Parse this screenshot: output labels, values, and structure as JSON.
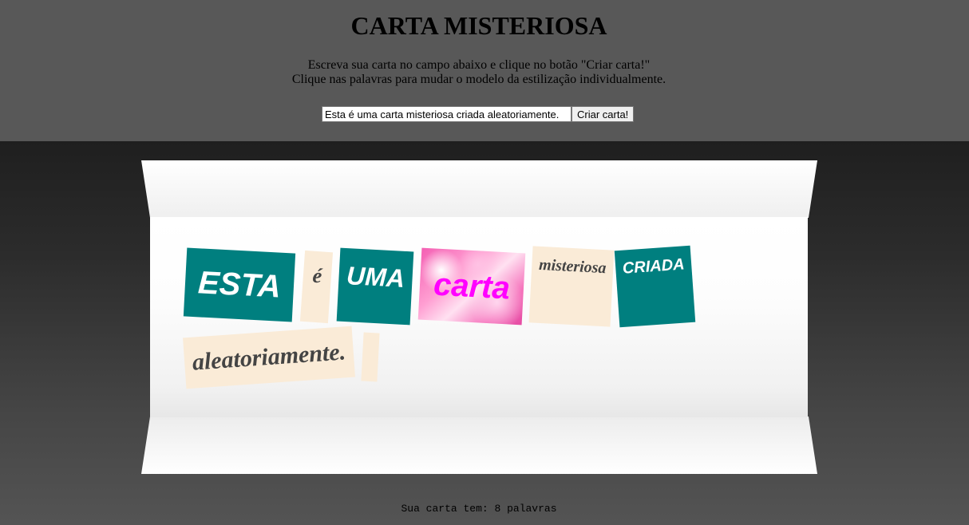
{
  "header": {
    "title": "CARTA MISTERIOSA",
    "instruction_1": "Escreva sua carta no campo abaixo e clique no botão \"Criar carta!\"",
    "instruction_2": "Clique nas palavras para mudar o modelo da estilização individualmente."
  },
  "form": {
    "input_value": "Esta é uma carta misteriosa criada aleatoriamente.",
    "button_label": "Criar carta!"
  },
  "letter": {
    "words": [
      {
        "text": "ESTA",
        "style": "teal-bold-italic"
      },
      {
        "text": "é",
        "style": "cream-serif-italic"
      },
      {
        "text": "UMA",
        "style": "teal-bold-italic"
      },
      {
        "text": "carta",
        "style": "pink-image-magenta"
      },
      {
        "text": "misteriosa",
        "style": "cream-serif-italic"
      },
      {
        "text": "CRIADA",
        "style": "teal-bold-italic"
      },
      {
        "text": "aleatoriamente.",
        "style": "cream-serif-italic"
      },
      {
        "text": "",
        "style": "cream-blank"
      }
    ]
  },
  "footer": {
    "word_count_text": "Sua carta tem: 8 palavras"
  },
  "colors": {
    "header_bg": "#585858",
    "teal": "#007f7f",
    "cream": "#faebd7",
    "magenta": "#ff00ff"
  }
}
